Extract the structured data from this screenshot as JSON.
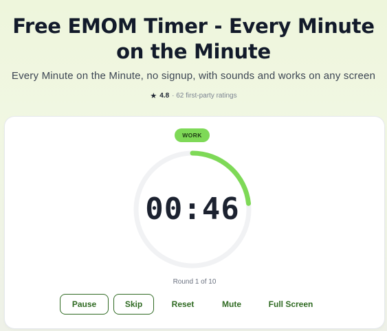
{
  "header": {
    "title_line1": "Free EMOM Timer - Every Minute",
    "title_line2": "on the Minute",
    "subtitle": "Every Minute on the Minute, no signup, with sounds and works on any screen",
    "rating": {
      "icon": "star-icon",
      "score": "4.8",
      "text": "· 62 first-party ratings"
    }
  },
  "timer": {
    "phase": "WORK",
    "time": "00:46",
    "progress_fraction": 0.233,
    "round_text": "Round 1 of 10",
    "colors": {
      "accent": "#7ed957",
      "track": "#f1f2f4",
      "text": "#1c2230",
      "button": "#2f6a22"
    }
  },
  "controls": {
    "pause": "Pause",
    "skip": "Skip",
    "reset": "Reset",
    "mute": "Mute",
    "fullscreen": "Full Screen"
  }
}
